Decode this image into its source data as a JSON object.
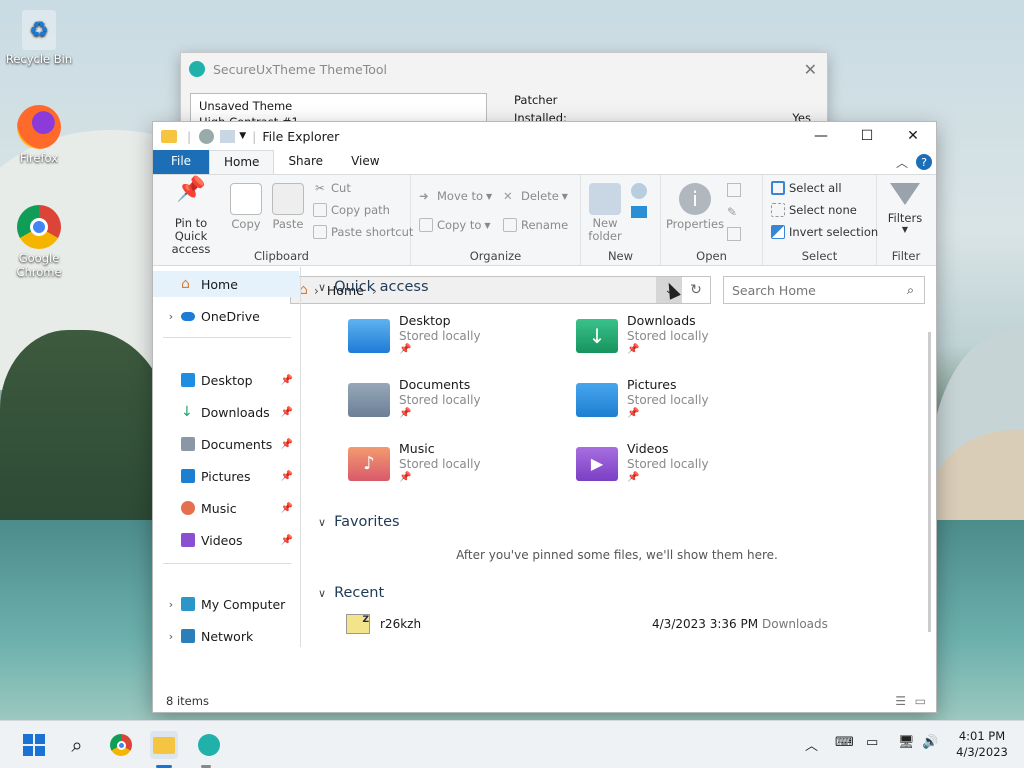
{
  "desktop": {
    "icons": [
      {
        "label": "Recycle Bin",
        "icon": "recycle-bin-icon"
      },
      {
        "label": "Firefox",
        "icon": "firefox-icon"
      },
      {
        "label": "Google Chrome",
        "icon": "chrome-icon"
      }
    ]
  },
  "themetool": {
    "title": "SecureUxTheme ThemeTool",
    "list_item_1": "Unsaved Theme",
    "list_item_2": "High Contrast #1",
    "patcher_label": "Patcher",
    "installed_label": "Installed:",
    "installed_value": "Yes"
  },
  "explorer": {
    "title": "File Explorer",
    "tabs": [
      "File",
      "Home",
      "Share",
      "View"
    ],
    "active_tab": "Home",
    "ribbon": {
      "clipboard": {
        "label": "Clipboard",
        "pin": "Pin to Quick access",
        "copy": "Copy",
        "paste": "Paste",
        "cut": "Cut",
        "copy_path": "Copy path",
        "paste_shortcut": "Paste shortcut"
      },
      "organize": {
        "label": "Organize",
        "move_to": "Move to",
        "copy_to": "Copy to",
        "delete": "Delete",
        "rename": "Rename"
      },
      "new": {
        "label": "New",
        "new_folder": "New folder"
      },
      "open": {
        "label": "Open",
        "properties": "Properties"
      },
      "select": {
        "label": "Select",
        "select_all": "Select all",
        "select_none": "Select none",
        "invert": "Invert selection"
      },
      "filter": {
        "label": "Filter",
        "filters": "Filters"
      }
    },
    "address": {
      "path": "Home",
      "search_placeholder": "Search Home"
    },
    "sidebar": [
      {
        "label": "Home",
        "expandable": false,
        "pinned": false
      },
      {
        "label": "OneDrive",
        "expandable": true,
        "pinned": false
      },
      {
        "label": "Desktop",
        "expandable": false,
        "pinned": true
      },
      {
        "label": "Downloads",
        "expandable": false,
        "pinned": true
      },
      {
        "label": "Documents",
        "expandable": false,
        "pinned": true
      },
      {
        "label": "Pictures",
        "expandable": false,
        "pinned": true
      },
      {
        "label": "Music",
        "expandable": false,
        "pinned": true
      },
      {
        "label": "Videos",
        "expandable": false,
        "pinned": true
      },
      {
        "label": "My Computer",
        "expandable": true,
        "pinned": false
      },
      {
        "label": "Network",
        "expandable": true,
        "pinned": false
      }
    ],
    "quick_access": {
      "heading": "Quick access",
      "items": [
        {
          "name": "Desktop",
          "sub": "Stored locally",
          "color": "#1e8fe0"
        },
        {
          "name": "Downloads",
          "sub": "Stored locally",
          "color": "#1ea36b"
        },
        {
          "name": "Documents",
          "sub": "Stored locally",
          "color": "#6b7f95"
        },
        {
          "name": "Pictures",
          "sub": "Stored locally",
          "color": "#1d7fd1"
        },
        {
          "name": "Music",
          "sub": "Stored locally",
          "color": "#e4704e"
        },
        {
          "name": "Videos",
          "sub": "Stored locally",
          "color": "#8b4fd1"
        }
      ]
    },
    "favorites": {
      "heading": "Favorites",
      "empty_text": "After you've pinned some files, we'll show them here."
    },
    "recent": {
      "heading": "Recent",
      "items": [
        {
          "name": "r26kzh",
          "date": "4/3/2023 3:36 PM",
          "location": "Downloads"
        }
      ]
    },
    "status": "8 items"
  },
  "taskbar": {
    "clock_time": "4:01 PM",
    "clock_date": "4/3/2023"
  }
}
